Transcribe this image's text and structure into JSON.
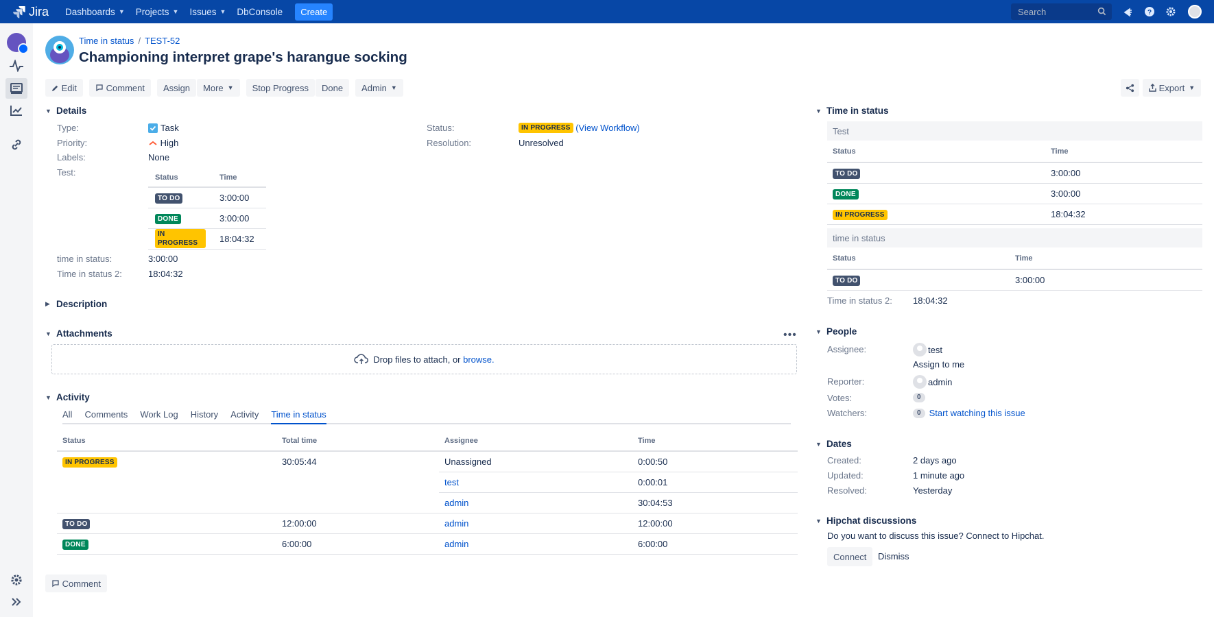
{
  "nav": {
    "brand": "Jira",
    "items": [
      "Dashboards",
      "Projects",
      "Issues",
      "DbConsole"
    ],
    "create_label": "Create",
    "search_placeholder": "Search"
  },
  "breadcrumbs": {
    "project": "Time in status",
    "issue_key": "TEST-52"
  },
  "issue_title": "Championing interpret grape's harangue socking",
  "toolbar": {
    "edit": "Edit",
    "comment": "Comment",
    "assign": "Assign",
    "more": "More",
    "stop_progress": "Stop Progress",
    "done": "Done",
    "admin": "Admin",
    "export": "Export"
  },
  "details": {
    "heading": "Details",
    "type_label": "Type:",
    "type_value": "Task",
    "priority_label": "Priority:",
    "priority_value": "High",
    "labels_label": "Labels:",
    "labels_value": "None",
    "test_label": "Test:",
    "status_label": "Status:",
    "status_value": "IN PROGRESS",
    "view_workflow": "(View Workflow)",
    "resolution_label": "Resolution:",
    "resolution_value": "Unresolved",
    "test_table": {
      "headers": [
        "Status",
        "Time"
      ],
      "rows": [
        {
          "status": "TO DO",
          "time": "3:00:00"
        },
        {
          "status": "DONE",
          "time": "3:00:00"
        },
        {
          "status": "IN PROGRESS",
          "time": "18:04:32"
        }
      ]
    },
    "tis_label": "time in status:",
    "tis_value": "3:00:00",
    "tis2_label": "Time in status 2:",
    "tis2_value": "18:04:32"
  },
  "description": {
    "heading": "Description"
  },
  "attachments": {
    "heading": "Attachments",
    "drop_text": "Drop files to attach, or",
    "browse": "browse."
  },
  "activity": {
    "heading": "Activity",
    "tabs": [
      "All",
      "Comments",
      "Work Log",
      "History",
      "Activity",
      "Time in status"
    ],
    "headers": [
      "Status",
      "Total time",
      "Assignee",
      "Time"
    ],
    "rows": {
      "r1": {
        "status": "IN PROGRESS",
        "total": "30:05:44",
        "assignee": "Unassigned",
        "time": "0:00:50"
      },
      "r2": {
        "assignee": "test",
        "time": "0:00:01"
      },
      "r3": {
        "assignee": "admin",
        "time": "30:04:53"
      },
      "r4": {
        "status": "TO DO",
        "total": "12:00:00",
        "assignee": "admin",
        "time": "12:00:00"
      },
      "r5": {
        "status": "DONE",
        "total": "6:00:00",
        "assignee": "admin",
        "time": "6:00:00"
      }
    },
    "comment_button": "Comment"
  },
  "right": {
    "tis_heading": "Time in status",
    "box1": {
      "title": "Test",
      "headers": [
        "Status",
        "Time"
      ],
      "rows": [
        {
          "status": "TO DO",
          "time": "3:00:00"
        },
        {
          "status": "DONE",
          "time": "3:00:00"
        },
        {
          "status": "IN PROGRESS",
          "time": "18:04:32"
        }
      ]
    },
    "box2": {
      "title": "time in status",
      "headers": [
        "Status",
        "Time"
      ],
      "rows": [
        {
          "status": "TO DO",
          "time": "3:00:00"
        }
      ]
    },
    "tis2_label": "Time in status 2:",
    "tis2_value": "18:04:32",
    "people": {
      "heading": "People",
      "assignee_label": "Assignee:",
      "assignee_value": "test",
      "assign_to_me": "Assign to me",
      "reporter_label": "Reporter:",
      "reporter_value": "admin",
      "votes_label": "Votes:",
      "votes_count": "0",
      "watchers_label": "Watchers:",
      "watchers_count": "0",
      "start_watching": "Start watching this issue"
    },
    "dates": {
      "heading": "Dates",
      "created_label": "Created:",
      "created_value": "2 days ago",
      "updated_label": "Updated:",
      "updated_value": "1 minute ago",
      "resolved_label": "Resolved:",
      "resolved_value": "Yesterday"
    },
    "hipchat": {
      "heading": "Hipchat discussions",
      "text": "Do you want to discuss this issue? Connect to Hipchat.",
      "connect": "Connect",
      "dismiss": "Dismiss"
    }
  },
  "colors": {
    "nav_bg": "#0747a6",
    "link": "#0052cc",
    "todo": "#42526e",
    "done": "#00875a",
    "inprogress": "#ffc400"
  }
}
